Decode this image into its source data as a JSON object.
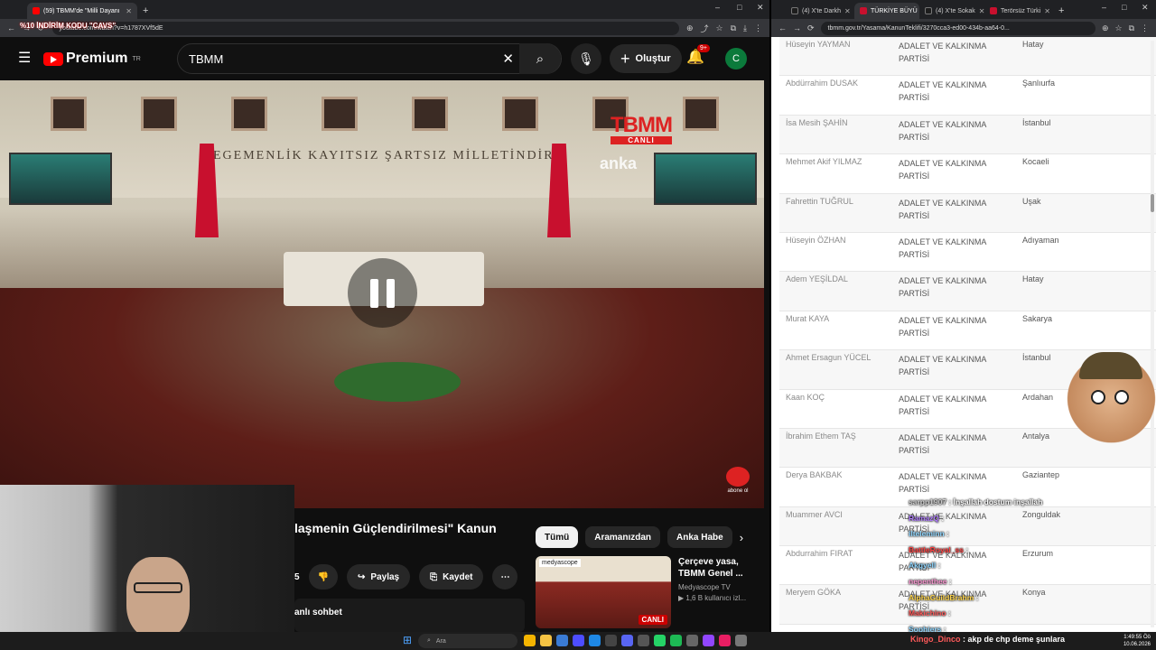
{
  "left_browser": {
    "tabs": [
      {
        "title": "(59) TBMM'de \"Milli Dayanı",
        "favicon_color": "#ff0000",
        "active": true
      }
    ],
    "new_tab": "+",
    "window_controls": [
      "–",
      "□",
      "✕"
    ],
    "url": "youtube.com/watch?v=h1787XVf5dE",
    "promo": "%10 İNDİRİM KODU \"CAVS\""
  },
  "youtube": {
    "logo": "Premium",
    "region": "TR",
    "search_value": "TBMM",
    "create_label": "Oluştur",
    "notifications": "9+",
    "avatar_letter": "C",
    "video_title": "laşmenin Güçlendirilmesi\" Kanun",
    "like_count": "5",
    "share_label": "Paylaş",
    "save_label": "Kaydet",
    "more": "⋯",
    "live_chat": "anlı sohbet",
    "chips": [
      "Tümü",
      "Aramanızdan",
      "Anka Habe"
    ],
    "rec": {
      "title": "Çerçeve yasa, TBMM Genel ...",
      "channel": "Medyascope TV",
      "viewers": "▶ 1,6 B kullanıcı izl...",
      "badge": "CANLI",
      "thumb_label": "medyascope"
    }
  },
  "video_overlay": {
    "motto": "EGEMENLİK KAYITSIZ ŞARTSIZ MİLLETİNDİR",
    "channel_logo": "TBMM",
    "live_tag": "CANLI",
    "watermark": "anka",
    "subscribe_tag": "abone ol"
  },
  "right_browser": {
    "tabs": [
      {
        "title": "(4) X'te Darkh",
        "favicon_color": "#1d1d1d"
      },
      {
        "title": "TÜRKİYE BÜYÜ",
        "favicon_color": "#c8102e",
        "active": true
      },
      {
        "title": "(4) X'te Sokak",
        "favicon_color": "#1d1d1d"
      },
      {
        "title": "Terörsüz Türki",
        "favicon_color": "#c8102e"
      }
    ],
    "url": "tbmm.gov.tr/Yasama/KanunTeklifi/3270cca3-ed00-434b-aa64-0...",
    "members": [
      {
        "name": "Hüseyin YAYMAN",
        "party": "ADALET VE KALKINMA PARTİSİ",
        "city": "Hatay"
      },
      {
        "name": "Abdürrahim DUSAK",
        "party": "ADALET VE KALKINMA PARTİSİ",
        "city": "Şanlıurfa"
      },
      {
        "name": "İsa Mesih ŞAHİN",
        "party": "ADALET VE KALKINMA PARTİSİ",
        "city": "İstanbul"
      },
      {
        "name": "Mehmet Akif YILMAZ",
        "party": "ADALET VE KALKINMA PARTİSİ",
        "city": "Kocaeli"
      },
      {
        "name": "Fahrettin TUĞRUL",
        "party": "ADALET VE KALKINMA PARTİSİ",
        "city": "Uşak"
      },
      {
        "name": "Hüseyin ÖZHAN",
        "party": "ADALET VE KALKINMA PARTİSİ",
        "city": "Adıyaman"
      },
      {
        "name": "Adem YEŞİLDAL",
        "party": "ADALET VE KALKINMA PARTİSİ",
        "city": "Hatay"
      },
      {
        "name": "Murat KAYA",
        "party": "ADALET VE KALKINMA PARTİSİ",
        "city": "Sakarya"
      },
      {
        "name": "Ahmet Ersagun YÜCEL",
        "party": "ADALET VE KALKINMA PARTİSİ",
        "city": "İstanbul"
      },
      {
        "name": "Kaan KOÇ",
        "party": "ADALET VE KALKINMA PARTİSİ",
        "city": "Ardahan"
      },
      {
        "name": "İbrahim Ethem TAŞ",
        "party": "ADALET VE KALKINMA PARTİSİ",
        "city": "Antalya"
      },
      {
        "name": "Derya BAKBAK",
        "party": "ADALET VE KALKINMA PARTİSİ",
        "city": "Gaziantep"
      },
      {
        "name": "Muammer AVCI",
        "party": "ADALET VE KALKINMA PARTİSİ",
        "city": "Zonguldak"
      },
      {
        "name": "Abdurrahim FIRAT",
        "party": "ADALET VE KALKINMA PARTİSİ",
        "city": "Erzurum"
      },
      {
        "name": "Meryem GÖKA",
        "party": "ADALET VE KALKINMA PARTİSİ",
        "city": "Konya"
      }
    ]
  },
  "stream_chat": [
    {
      "user": "sarpp1907",
      "msg": "İnşallah dostum inşallah",
      "color": "#d0d0d0"
    },
    {
      "user": "RamazQ",
      "msg": "",
      "color": "#b07cff"
    },
    {
      "user": "ilteleminn",
      "msg": "",
      "color": "#8fd6ff"
    },
    {
      "user": "BattleRoyal_ss",
      "msg": "",
      "color": "#ff4040"
    },
    {
      "user": "Akgyell",
      "msg": "",
      "color": "#8fd6ff"
    },
    {
      "user": "nepenthee",
      "msg": "",
      "color": "#ff9ad5"
    },
    {
      "user": "AlphaGuildBrahm",
      "msg": "",
      "color": "#ffd54a"
    },
    {
      "user": "Makichino",
      "msg": "",
      "color": "#ff5a5a"
    },
    {
      "user": "Sophiers",
      "msg": "",
      "color": "#8fd6ff"
    }
  ],
  "taskbar": {
    "search_placeholder": "Ara",
    "ticker_user": "Kingo_Dinco",
    "ticker_msg": " : akp de chp deme şunlara",
    "time": "1:49:55 Öö",
    "date": "10.06.2026"
  }
}
